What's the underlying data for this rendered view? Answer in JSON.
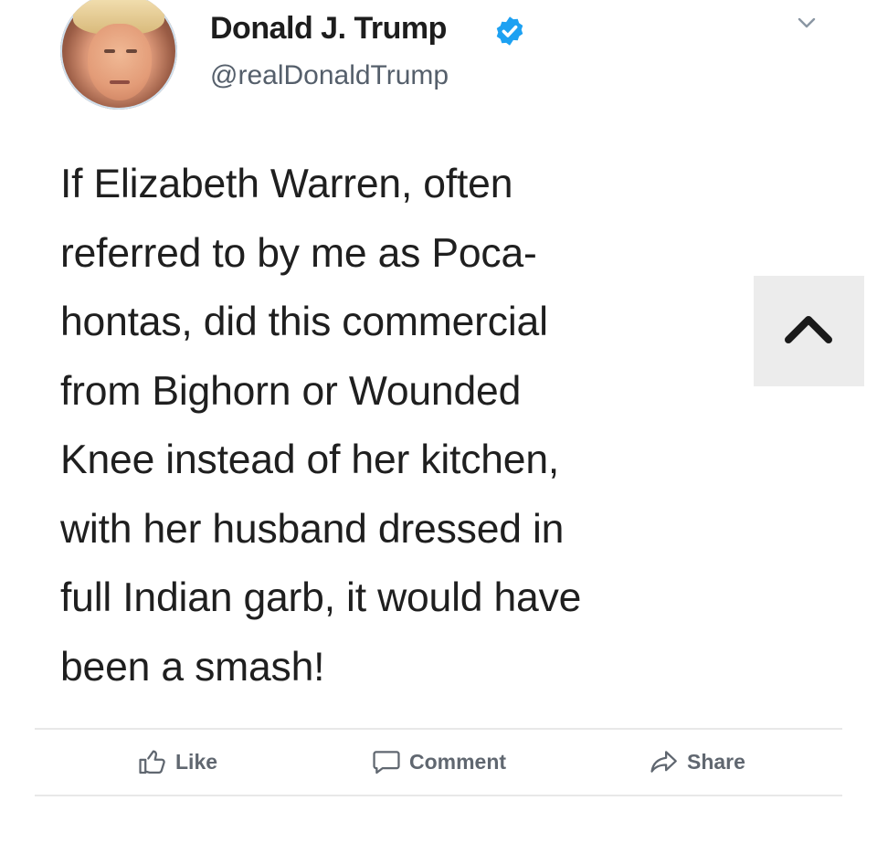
{
  "author": {
    "name": "Donald J. Trump",
    "handle": "@realDonaldTrump",
    "verified": true,
    "avatar_icon": "profile-photo"
  },
  "tweet": {
    "lines": [
      "If Elizabeth Warren, often",
      "referred to by me as Poca-",
      "hontas, did this commercial",
      "from Bighorn or Wounded",
      "Knee instead of her kitchen,",
      "with her husband dressed in",
      "full Indian garb, it would have",
      "been a smash!"
    ]
  },
  "actions": {
    "like": {
      "label": "Like",
      "icon": "thumbs-up-icon"
    },
    "comment": {
      "label": "Comment",
      "icon": "comment-bubble-icon"
    },
    "share": {
      "label": "Share",
      "icon": "share-arrow-icon"
    }
  },
  "icons": {
    "menu": "chevron-down-icon",
    "scroll": "chevron-up-icon",
    "verified": "verified-badge-icon"
  },
  "colors": {
    "verified_badge": "#1da1f2",
    "action_text": "#606770",
    "divider": "#e8e8e8",
    "scroll_button_bg": "#ececec"
  }
}
